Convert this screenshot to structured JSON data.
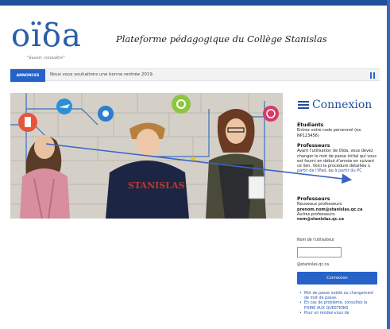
{
  "header": {
    "logo_text": "oïδa",
    "slogan": "\"Savoir, connaître\"",
    "site_title": "Plateforme pédagogique du Collège Stanislas"
  },
  "announcement": {
    "badge": "ANNONCES",
    "text": "Nous vous souhaitons une bonne rentrée 2019."
  },
  "login": {
    "title": "Connexion",
    "students_heading": "Étudiants",
    "students_text": "Entrez votre code personnel (ex: NP123456)",
    "teachers_heading": "Professeurs",
    "teachers_text_1": "Avant l'utilisation de Oïda, vous devez changer le mot de passe initial qui vous est fourni en début d'année en suivant ce lien. Voici la procédure détaillée",
    "teachers_link_ipad": "à partir de l'iPad",
    "teachers_text_2": ", ou",
    "teachers_link_pc": "à partir du PC",
    "teachers2_heading": "Professeurs",
    "new_teachers_label": "Nouveaux professeurs:",
    "new_teachers_value": "prenom.nom@stanislas.qc.ca",
    "other_teachers_label": "Autres professeurs:",
    "other_teachers_value": "nom@stanislas.qc.ca",
    "username_label": "Nom de l'utilisateur",
    "username_value": "",
    "domain": "@stanislas.qc.ca",
    "submit_label": "Connexion",
    "help": [
      "Mot de passe oublié ou changement de mot de passe.",
      "En cas de problème, consultez la FOIRE AUX QUESTIONS",
      "Pour un rendez-vous de"
    ]
  },
  "hero": {
    "sweater_text": "STANISLAS"
  },
  "colors": {
    "brand_blue": "#2663c9",
    "title_blue": "#1f4e9a",
    "arrow": "#3b62c4"
  }
}
